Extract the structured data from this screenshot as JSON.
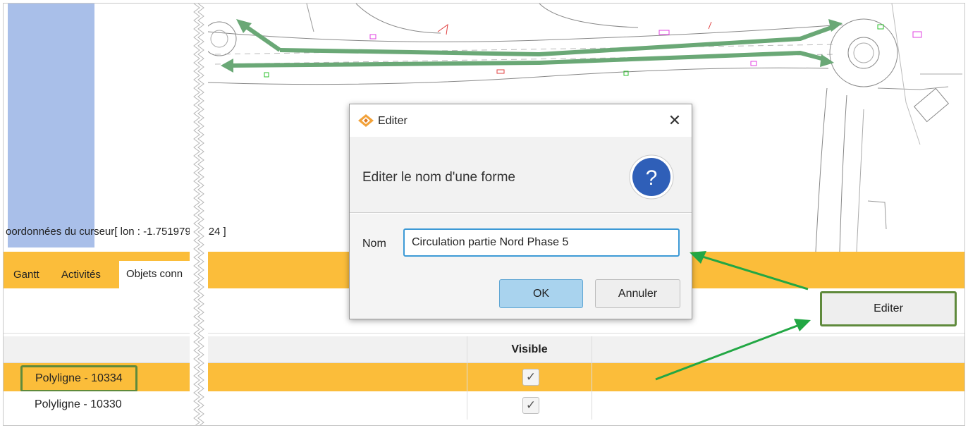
{
  "map": {
    "cursor_coords": "oordonnées du curseur[ lon : -1.75197943124 ]"
  },
  "tabs": [
    {
      "label": "Gantt"
    },
    {
      "label": "Activités"
    },
    {
      "label": "Objets conn"
    }
  ],
  "toolbar": {
    "edit_label": "Editer"
  },
  "table": {
    "visible_header": "Visible",
    "rows": [
      {
        "label": "Polyligne - 10334",
        "visible": true,
        "selected": true
      },
      {
        "label": "Polyligne - 10330",
        "visible": true,
        "selected": false
      }
    ]
  },
  "dialog": {
    "title": "Editer",
    "close_icon": "close-icon",
    "header_text": "Editer le nom d'une forme",
    "help_icon": "question-icon",
    "name_label": "Nom",
    "name_value": "Circulation partie Nord Phase 5",
    "ok_label": "OK",
    "cancel_label": "Annuler"
  },
  "colors": {
    "accent_orange": "#fbbd3a",
    "highlight_green": "#5f8a3c",
    "arrow_green": "#4caf50",
    "blue_panel": "#a9bfe9",
    "help_blue": "#2f5fb8"
  }
}
